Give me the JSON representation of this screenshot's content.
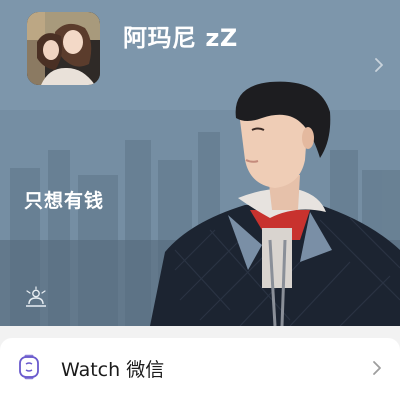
{
  "profile": {
    "nickname": "阿玛尼 zZ",
    "signature": "只想有钱"
  },
  "icons": {
    "avatar": "avatar-photo",
    "profile_chevron": "chevron-right-icon",
    "status": "status-icon",
    "watch": "watch-icon",
    "watch_chevron": "chevron-right-icon"
  },
  "watch": {
    "label": "Watch 微信"
  },
  "colors": {
    "hero_overlay": "#7f98ad",
    "text_on_hero": "#ffffff",
    "card_bg": "#ffffff",
    "page_bg": "#f2f2f2",
    "watch_icon_accent": "#576b95"
  }
}
